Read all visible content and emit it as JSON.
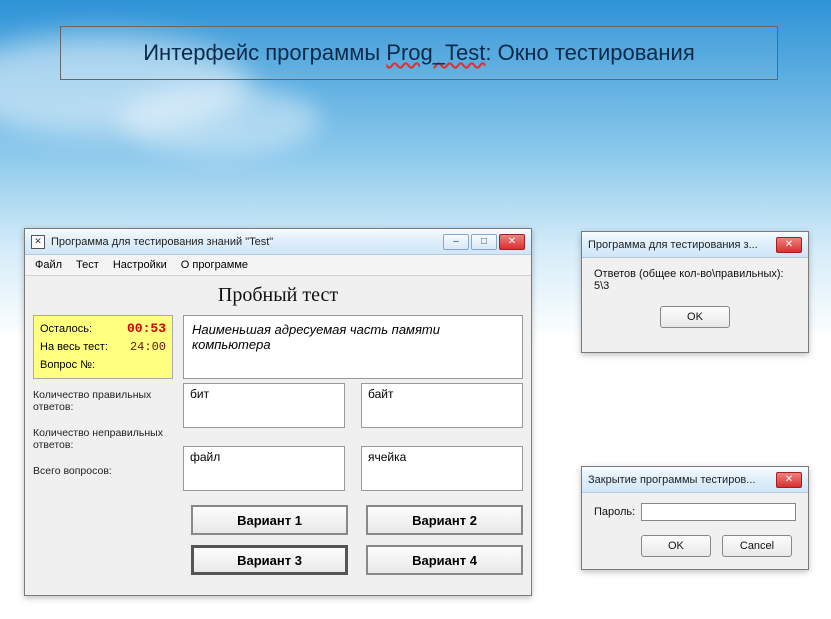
{
  "slide": {
    "title_prefix": "Интерфейс программы ",
    "title_prog": "Prog_Test",
    "title_suffix": ": Окно тестирования"
  },
  "main_window": {
    "title": "Программа для тестирования знаний \"Test\"",
    "menu": {
      "file": "Файл",
      "test": "Тест",
      "settings": "Настройки",
      "about": "О программе"
    },
    "heading": "Пробный тест",
    "timer": {
      "remain_label": "Осталось:",
      "remain_value": "00:53",
      "total_label": "На весь тест:",
      "total_value": "24:00",
      "question_label": "Вопрос №:"
    },
    "question_text": "Наименьшая адресуемая часть памяти компьютера",
    "stats": {
      "correct_label": "Количество правильных ответов:",
      "wrong_label": "Количество неправильных ответов:",
      "total_label": "Всего вопросов:"
    },
    "answers": [
      "бит",
      "байт",
      "файл",
      "ячейка"
    ],
    "variants": [
      "Вариант 1",
      "Вариант 2",
      "Вариант 3",
      "Вариант 4"
    ]
  },
  "result_dialog": {
    "title": "Программа для тестирования з...",
    "line1": "Ответов (общее кол-во\\правильных):",
    "line2": "5\\3",
    "ok": "OK"
  },
  "close_dialog": {
    "title": "Закрытие программы тестиров...",
    "password_label": "Пароль:",
    "ok": "OK",
    "cancel": "Cancel"
  }
}
